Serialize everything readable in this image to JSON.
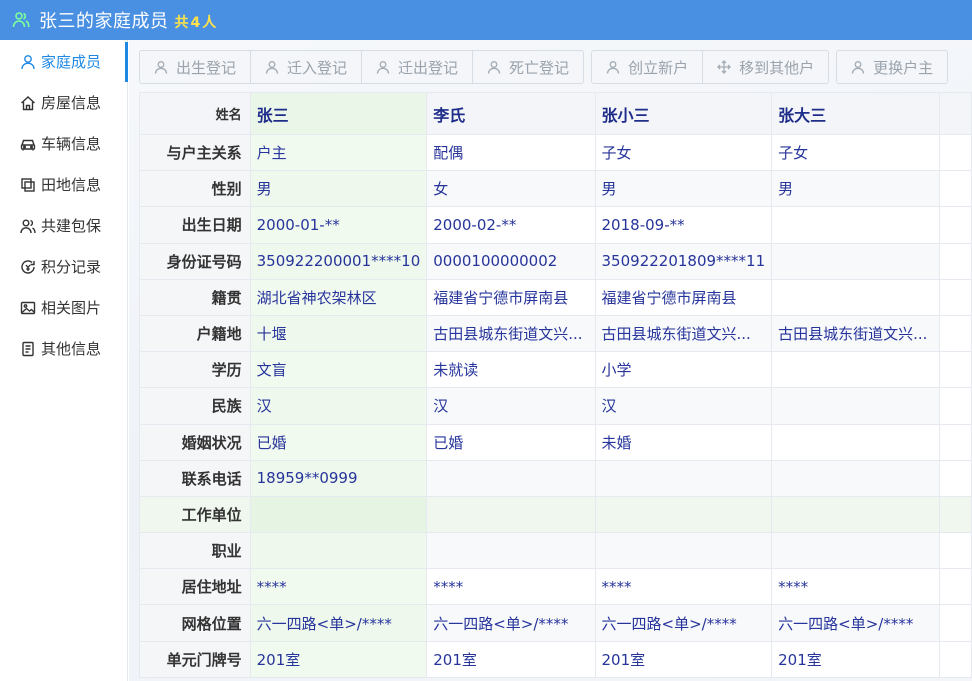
{
  "header": {
    "title": "张三的家庭成员",
    "count_label": "共",
    "count": "4",
    "count_unit": "人",
    "logo_icon": "family-icon"
  },
  "sidebar": {
    "items": [
      {
        "label": "家庭成员",
        "icon": "person-icon",
        "active": true
      },
      {
        "label": "房屋信息",
        "icon": "house-icon",
        "active": false
      },
      {
        "label": "车辆信息",
        "icon": "car-icon",
        "active": false
      },
      {
        "label": "田地信息",
        "icon": "field-icon",
        "active": false
      },
      {
        "label": "共建包保",
        "icon": "group-icon",
        "active": false
      },
      {
        "label": "积分记录",
        "icon": "points-icon",
        "active": false
      },
      {
        "label": "相关图片",
        "icon": "image-icon",
        "active": false
      },
      {
        "label": "其他信息",
        "icon": "document-icon",
        "active": false
      }
    ]
  },
  "toolbar": {
    "groups": [
      [
        {
          "label": "出生登记",
          "icon": "person-icon"
        },
        {
          "label": "迁入登记",
          "icon": "person-icon"
        },
        {
          "label": "迁出登记",
          "icon": "person-icon"
        },
        {
          "label": "死亡登记",
          "icon": "person-icon"
        }
      ],
      [
        {
          "label": "创立新户",
          "icon": "person-icon"
        },
        {
          "label": "移到其他户",
          "icon": "move-icon"
        }
      ],
      [
        {
          "label": "更换户主",
          "icon": "person-icon"
        }
      ]
    ]
  },
  "table": {
    "name_label": "姓名",
    "members": [
      "张三",
      "李氏",
      "张小三",
      "张大三"
    ],
    "rows": [
      {
        "label": "与户主关系",
        "values": [
          "户主",
          "配偶",
          "子女",
          "子女"
        ]
      },
      {
        "label": "性别",
        "values": [
          "男",
          "女",
          "男",
          "男"
        ]
      },
      {
        "label": "出生日期",
        "values": [
          "2000-01-**",
          "2000-02-**",
          "2018-09-**",
          ""
        ]
      },
      {
        "label": "身份证号码",
        "values": [
          "350922200001****10",
          "0000100000002",
          "350922201809****11",
          ""
        ]
      },
      {
        "label": "籍贯",
        "values": [
          "湖北省神农架林区",
          "福建省宁德市屏南县",
          "福建省宁德市屏南县",
          ""
        ]
      },
      {
        "label": "户籍地",
        "values": [
          "十堰",
          "古田县城东街道文兴...",
          "古田县城东街道文兴...",
          "古田县城东街道文兴..."
        ]
      },
      {
        "label": "学历",
        "values": [
          "文盲",
          "未就读",
          "小学",
          ""
        ]
      },
      {
        "label": "民族",
        "values": [
          "汉",
          "汉",
          "汉",
          ""
        ]
      },
      {
        "label": "婚姻状况",
        "values": [
          "已婚",
          "已婚",
          "未婚",
          ""
        ]
      },
      {
        "label": "联系电话",
        "values": [
          "18959**0999",
          "",
          "",
          ""
        ]
      },
      {
        "label": "工作单位",
        "values": [
          "",
          "",
          "",
          ""
        ],
        "highlight": true
      },
      {
        "label": "职业",
        "values": [
          "",
          "",
          "",
          ""
        ]
      },
      {
        "label": "居住地址",
        "values": [
          "****",
          "****",
          "****",
          "****"
        ]
      },
      {
        "label": "网格位置",
        "values": [
          "六一四路<单>/****",
          "六一四路<单>/****",
          "六一四路<单>/****",
          "六一四路<单>/****"
        ]
      },
      {
        "label": "单元门牌号",
        "values": [
          "201室",
          "201室",
          "201室",
          "201室"
        ]
      }
    ]
  }
}
